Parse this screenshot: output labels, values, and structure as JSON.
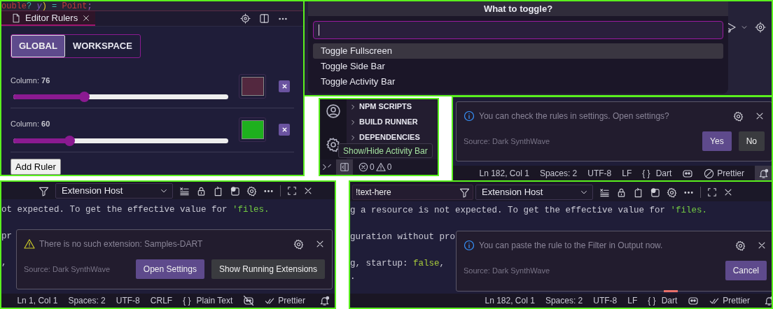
{
  "rulers_panel": {
    "code": [
      {
        "text": "ouble",
        "kind": "type"
      },
      {
        "text": "?",
        "kind": "op"
      },
      {
        "text": " y",
        "kind": "param"
      },
      {
        "text": ")",
        "kind": "paren"
      },
      {
        "text": " = ",
        "kind": "op"
      },
      {
        "text": "Point",
        "kind": "type"
      },
      {
        "text": ";",
        "kind": "punct"
      }
    ],
    "tab": {
      "title": "Editor Rulers"
    },
    "scopes": [
      {
        "label": "GLOBAL",
        "selected": true
      },
      {
        "label": "WORKSPACE",
        "selected": false
      }
    ],
    "rulers": [
      {
        "label": "Column: **76**",
        "level": 0.33,
        "color": "#53283f"
      },
      {
        "label": "Column: **60**",
        "level": 0.26,
        "color": "#1eb01e"
      }
    ],
    "add_button": "Add Ruler"
  },
  "quick_pick": {
    "title": "What to toggle?",
    "items": [
      {
        "label": "Toggle Fullscreen",
        "selected": true
      },
      {
        "label": "Toggle Side Bar",
        "selected": false
      },
      {
        "label": "Toggle Activity Bar",
        "selected": false
      }
    ]
  },
  "activity_panel": {
    "sections": [
      "NPM SCRIPTS",
      "BUILD RUNNER",
      "DEPENDENCIES"
    ],
    "tooltip": "Show/Hide Activity Bar",
    "errors": "0",
    "warnings": "0"
  },
  "settings_notice": {
    "kind": "info",
    "message": "You can check the rules in settings. Open settings?",
    "source": "Source: Dark SynthWave",
    "buttons": [
      {
        "label": "Yes",
        "kind": "primary"
      },
      {
        "label": "No",
        "kind": "secondary"
      }
    ],
    "status_bar": [
      {
        "kind": "text",
        "text": "Ln 182, Col 1"
      },
      {
        "kind": "text",
        "text": "Spaces: 2"
      },
      {
        "kind": "text",
        "text": "UTF-8"
      },
      {
        "kind": "text",
        "text": "LF"
      },
      {
        "kind": "language",
        "braces": "{ }",
        "text": "Dart"
      },
      {
        "kind": "copilot"
      },
      {
        "kind": "prettier_disabled",
        "text": "Prettier"
      },
      {
        "kind": "bell",
        "active": true
      }
    ]
  },
  "extension_panel": {
    "output_channel": "Extension Host",
    "code": [
      [
        {
          "text": "ot expected. To get the effective value for ",
          "kind": "plain"
        },
        {
          "text": "'files.",
          "kind": "string"
        }
      ],
      [
        {
          "text": "pr",
          "kind": "plain"
        }
      ],
      [
        {
          "text": ",",
          "kind": "plain"
        }
      ]
    ],
    "notice": {
      "kind": "warning",
      "message": "There is no such extension: Samples-DART",
      "source": "Source: Dark SynthWave",
      "buttons": [
        {
          "label": "Open Settings",
          "kind": "primary"
        },
        {
          "label": "Show Running Extensions",
          "kind": "secondary"
        }
      ]
    },
    "status_bar": [
      {
        "kind": "text",
        "text": "Ln 1, Col 1"
      },
      {
        "kind": "text",
        "text": "Spaces: 2"
      },
      {
        "kind": "text",
        "text": "UTF-8"
      },
      {
        "kind": "text",
        "text": "CRLF"
      },
      {
        "kind": "language",
        "braces": "{ }",
        "text": "Plain Text"
      },
      {
        "kind": "copilot_off"
      },
      {
        "kind": "prettier_ready",
        "text": "Prettier"
      },
      {
        "kind": "bell",
        "active": false
      }
    ]
  },
  "filter_panel": {
    "filter": "!text-here",
    "output_channel": "Extension Host",
    "code": [
      [
        {
          "text": "g a resource is not expected. To get the effective value for ",
          "kind": "plain"
        },
        {
          "text": "'files.",
          "kind": "string"
        }
      ],
      [
        {
          "text": "guration without pro",
          "kind": "plain"
        }
      ],
      [
        {
          "text": "g, startup: ",
          "kind": "plain"
        },
        {
          "text": "false",
          "kind": "keyword"
        },
        {
          "text": ",",
          "kind": "plain"
        }
      ],
      [
        {
          "text": ".",
          "kind": "plain"
        }
      ]
    ],
    "notice": {
      "kind": "info",
      "message": "You can paste the rule to the Filter in Output now.",
      "source": "Source: Dark SynthWave",
      "buttons": [
        {
          "label": "Cancel",
          "kind": "primary"
        }
      ]
    },
    "status_bar": [
      {
        "kind": "text",
        "text": "Ln 182, Col 1"
      },
      {
        "kind": "text",
        "text": "Spaces: 2"
      },
      {
        "kind": "text",
        "text": "UTF-8"
      },
      {
        "kind": "text",
        "text": "LF"
      },
      {
        "kind": "language",
        "braces": "{ }",
        "text": "Dart"
      },
      {
        "kind": "copilot"
      },
      {
        "kind": "prettier_ready",
        "text": "Prettier"
      },
      {
        "kind": "bell",
        "active": false
      }
    ]
  }
}
